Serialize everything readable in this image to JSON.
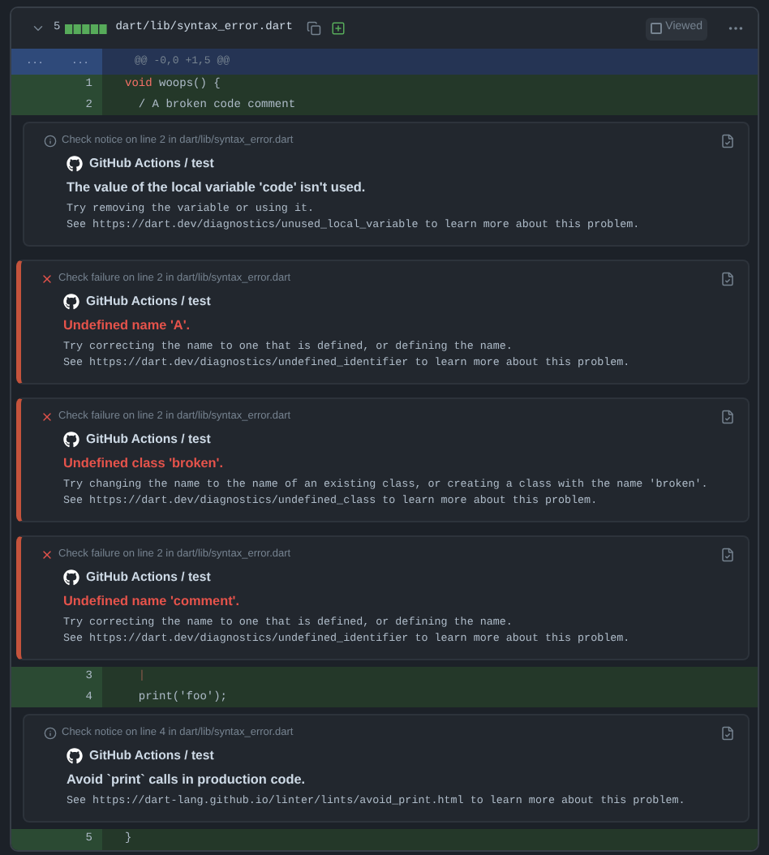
{
  "file": {
    "change_count": "5",
    "path": "dart/lib/syntax_error.dart",
    "viewed_label": "Viewed",
    "viewed": false
  },
  "hunk": {
    "old_marker": "...",
    "new_marker": "...",
    "header": "@@ -0,0 +1,5 @@"
  },
  "items": [
    {
      "kind": "line",
      "number": "1",
      "code": [
        {
          "text": "void",
          "kind": "keyword"
        },
        {
          "text": " woops() {",
          "kind": "plain"
        }
      ]
    },
    {
      "kind": "line",
      "number": "2",
      "code": [
        {
          "text": "  / A broken code comment",
          "kind": "plain"
        }
      ]
    },
    {
      "kind": "notice",
      "location": "Check notice on line 2 in dart/lib/syntax_error.dart",
      "author": "GitHub Actions / test",
      "title": "The value of the local variable 'code' isn't used.",
      "body": [
        "Try removing the variable or using it.",
        "See https://dart.dev/diagnostics/unused_local_variable to learn more about this problem."
      ]
    },
    {
      "kind": "failure",
      "location": "Check failure on line 2 in dart/lib/syntax_error.dart",
      "author": "GitHub Actions / test",
      "title": "Undefined name 'A'.",
      "body": [
        "Try correcting the name to one that is defined, or defining the name.",
        "See https://dart.dev/diagnostics/undefined_identifier to learn more about this problem."
      ]
    },
    {
      "kind": "failure",
      "location": "Check failure on line 2 in dart/lib/syntax_error.dart",
      "author": "GitHub Actions / test",
      "title": "Undefined class 'broken'.",
      "body": [
        "Try changing the name to the name of an existing class, or creating a class with the name 'broken'.",
        "See https://dart.dev/diagnostics/undefined_class to learn more about this problem."
      ]
    },
    {
      "kind": "failure",
      "location": "Check failure on line 2 in dart/lib/syntax_error.dart",
      "author": "GitHub Actions / test",
      "title": "Undefined name 'comment'.",
      "body": [
        "Try correcting the name to one that is defined, or defining the name.",
        "See https://dart.dev/diagnostics/undefined_identifier to learn more about this problem."
      ]
    },
    {
      "kind": "line",
      "number": "3",
      "code": [
        {
          "text": "  |",
          "kind": "marker"
        }
      ]
    },
    {
      "kind": "line",
      "number": "4",
      "code": [
        {
          "text": "  print('foo');",
          "kind": "plain"
        }
      ]
    },
    {
      "kind": "notice",
      "location": "Check notice on line 4 in dart/lib/syntax_error.dart",
      "author": "GitHub Actions / test",
      "title": "Avoid `print` calls in production code.",
      "body": [
        "See https://dart-lang.github.io/linter/lints/avoid_print.html to learn more about this problem."
      ]
    },
    {
      "kind": "line",
      "number": "5",
      "code": [
        {
          "text": "}",
          "kind": "plain"
        }
      ]
    }
  ]
}
